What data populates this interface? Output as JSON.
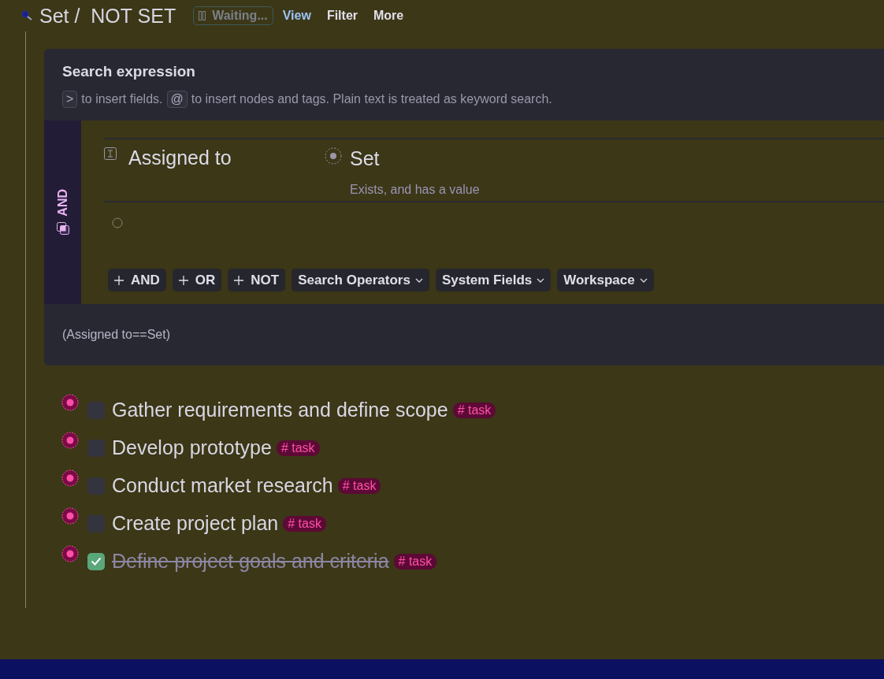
{
  "header": {
    "title": "Set /  NOT SET",
    "status": "Waiting...",
    "menu": [
      {
        "label": "View",
        "selected": true
      },
      {
        "label": "Filter",
        "selected": false
      },
      {
        "label": "More",
        "selected": false
      }
    ]
  },
  "search_panel": {
    "title": "Search expression",
    "hint": [
      {
        "kind": "key",
        "text": ">"
      },
      {
        "kind": "text",
        "text": "to insert fields."
      },
      {
        "kind": "key",
        "text": "@"
      },
      {
        "kind": "text",
        "text": "to insert nodes and tags. Plain text is treated as keyword search."
      }
    ],
    "group": {
      "operator": "AND",
      "conditions": [
        {
          "field": "Assigned to",
          "value": "Set",
          "description": "Exists, and has a value"
        }
      ],
      "buttons": [
        {
          "kind": "add",
          "label": "AND"
        },
        {
          "kind": "add",
          "label": "OR"
        },
        {
          "kind": "add",
          "label": "NOT"
        },
        {
          "kind": "dropdown",
          "label": "Search Operators"
        },
        {
          "kind": "dropdown",
          "label": "System Fields"
        },
        {
          "kind": "dropdown",
          "label": "Workspace"
        }
      ]
    },
    "formula": "(Assigned to==Set)"
  },
  "tasks": [
    {
      "text": "Gather requirements and define scope",
      "checked": false,
      "tag": "# task"
    },
    {
      "text": "Develop prototype",
      "checked": false,
      "tag": "# task"
    },
    {
      "text": "Conduct market research",
      "checked": false,
      "tag": "# task"
    },
    {
      "text": "Create project plan",
      "checked": false,
      "tag": "# task"
    },
    {
      "text": "Define project goals and criteria",
      "checked": true,
      "tag": "# task"
    }
  ]
}
